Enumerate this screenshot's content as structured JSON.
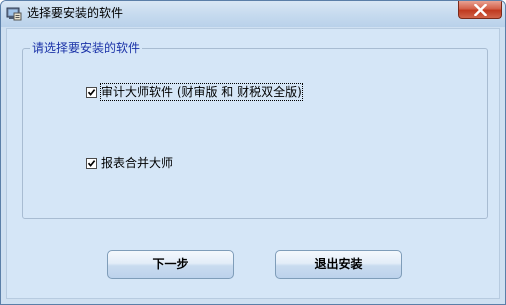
{
  "window": {
    "title": "选择要安装的软件"
  },
  "group": {
    "title": "请选择要安装的软件"
  },
  "options": [
    {
      "label": "审计大师软件 (财审版 和 财税双全版)",
      "checked": true
    },
    {
      "label": "报表合并大师",
      "checked": true
    }
  ],
  "buttons": {
    "next_label": "下一步",
    "exit_label": "退出安装"
  },
  "icons": {
    "app": "installer-icon",
    "close": "close-icon",
    "check": "check-icon"
  },
  "colors": {
    "window_bg": "#cfe0f1",
    "group_title": "#1b33a8",
    "close_button": "#c74a33"
  }
}
